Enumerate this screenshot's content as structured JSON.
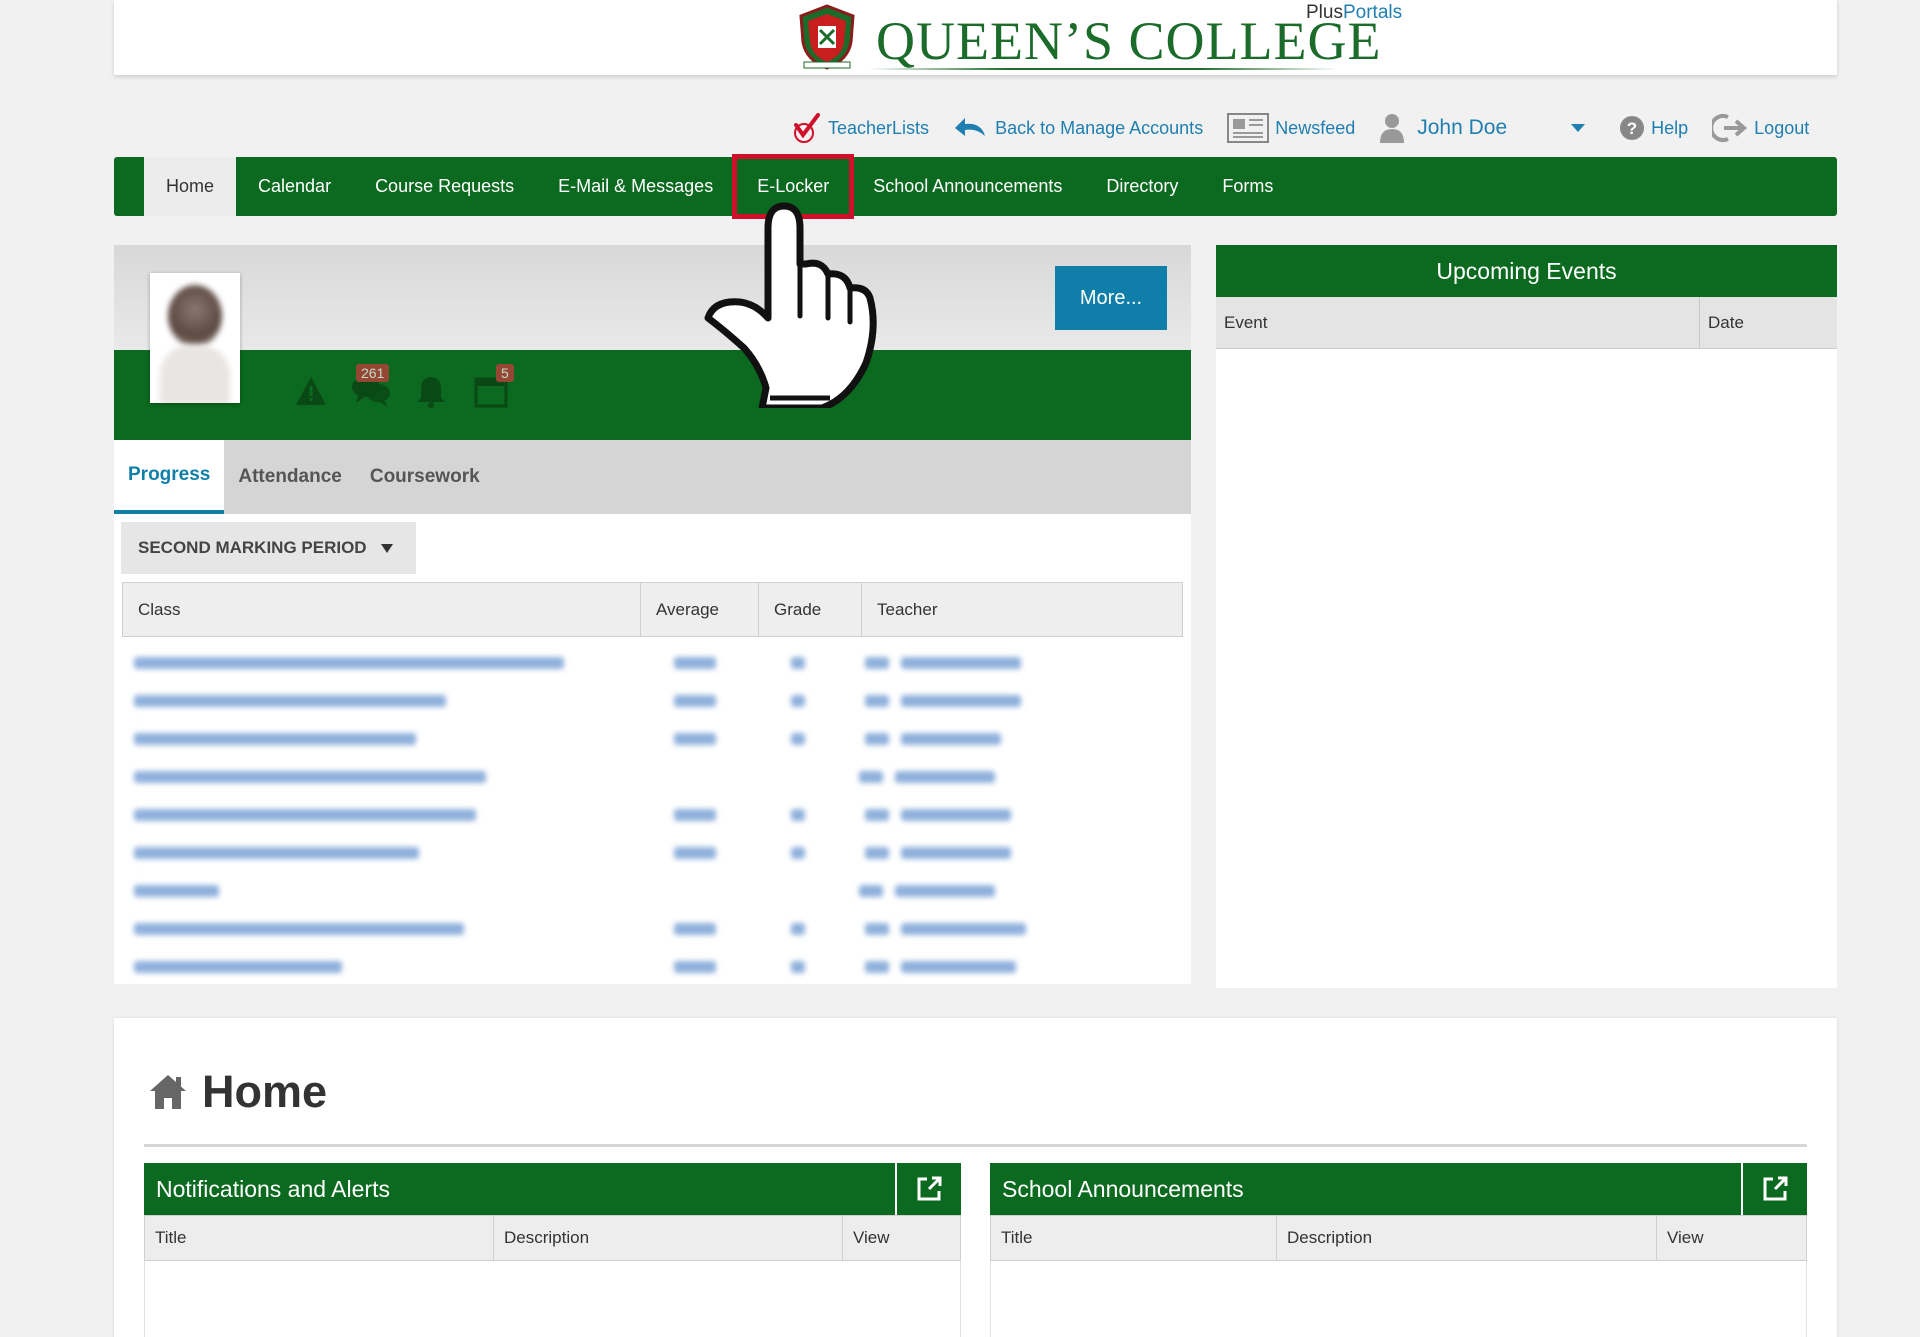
{
  "header": {
    "brand_title": "QUEEN’S COLLEGE",
    "brand_plus_1": "Plus",
    "brand_plus_2": "Portals"
  },
  "toplinks": {
    "teacherlists": "TeacherLists",
    "back_accounts": "Back to Manage Accounts",
    "newsfeed": "Newsfeed",
    "user_name": "John Doe",
    "help": "Help",
    "logout": "Logout"
  },
  "nav": {
    "items": [
      "Home",
      "Calendar",
      "Course Requests",
      "E-Mail & Messages",
      "E-Locker",
      "School Announcements",
      "Directory",
      "Forms"
    ],
    "active": "Home",
    "highlighted": "E-Locker"
  },
  "profile": {
    "more_label": "More...",
    "messages_count": "261",
    "calendar_count": "5"
  },
  "progress": {
    "tabs": [
      "Progress",
      "Attendance",
      "Coursework"
    ],
    "period_label": "SECOND MARKING PERIOD",
    "columns": [
      "Class",
      "Average",
      "Grade",
      "Teacher"
    ]
  },
  "events": {
    "title": "Upcoming Events",
    "columns": [
      "Event",
      "Date"
    ]
  },
  "home": {
    "title": "Home",
    "notifications": {
      "title": "Notifications and Alerts",
      "columns": [
        "Title",
        "Description",
        "View"
      ]
    },
    "announcements": {
      "title": "School Announcements",
      "columns": [
        "Title",
        "Description",
        "View"
      ]
    }
  },
  "colors": {
    "brand_green": "#0b6a1f",
    "link_blue": "#1e7fb0",
    "highlight_red": "#d0102a"
  }
}
